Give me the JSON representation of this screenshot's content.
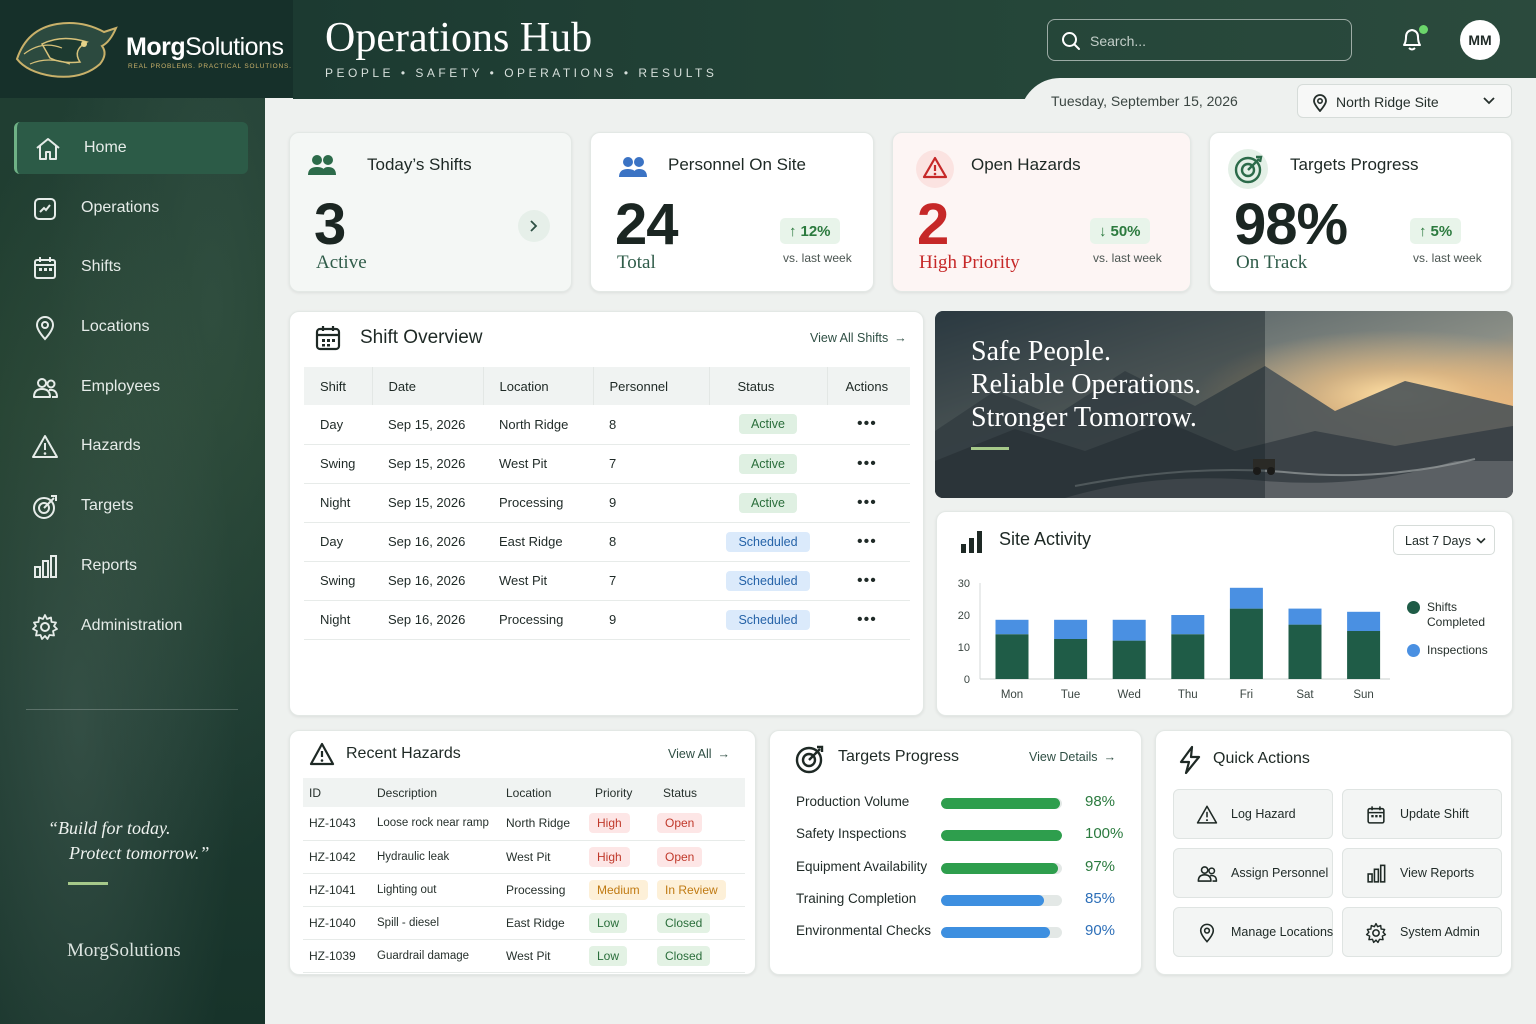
{
  "brand": {
    "name_bold": "Morg",
    "name_light": "Solutions",
    "tagline": "REAL PROBLEMS. PRACTICAL SOLUTIONS."
  },
  "nav": [
    {
      "label": "Home",
      "icon": "home-icon",
      "active": true
    },
    {
      "label": "Operations",
      "icon": "operations-icon"
    },
    {
      "label": "Shifts",
      "icon": "calendar-icon"
    },
    {
      "label": "Locations",
      "icon": "location-pin-icon"
    },
    {
      "label": "Employees",
      "icon": "users-icon"
    },
    {
      "label": "Hazards",
      "icon": "warning-icon"
    },
    {
      "label": "Targets",
      "icon": "target-icon"
    },
    {
      "label": "Reports",
      "icon": "bar-chart-icon"
    },
    {
      "label": "Administration",
      "icon": "gear-icon"
    }
  ],
  "sidebar_quote": {
    "line1": "“Build for today.",
    "line2": "Protect tomorrow.”",
    "signature": "MorgSolutions"
  },
  "header": {
    "title": "Operations Hub",
    "subtitle": "PEOPLE   •   SAFETY   •   OPERATIONS   •   RESULTS",
    "search_placeholder": "Search...",
    "avatar_initials": "MM",
    "date": "Tuesday, September 15, 2026",
    "site": "North Ridge Site"
  },
  "kpis": {
    "shifts": {
      "title": "Today’s Shifts",
      "value": "3",
      "sub": "Active"
    },
    "personnel": {
      "title": "Personnel On Site",
      "value": "24",
      "sub": "Total",
      "delta": "12%",
      "vs": "vs. last week"
    },
    "hazards": {
      "title": "Open Hazards",
      "value": "2",
      "sub": "High Priority",
      "delta": "50%",
      "vs": "vs. last week"
    },
    "targets": {
      "title": "Targets Progress",
      "value": "98%",
      "sub": "On Track",
      "delta": "5%",
      "vs": "vs. last week"
    }
  },
  "shift_overview": {
    "title": "Shift Overview",
    "link": "View All Shifts",
    "columns": [
      "Shift",
      "Date",
      "Location",
      "Personnel",
      "Status",
      "Actions"
    ],
    "rows": [
      {
        "shift": "Day",
        "date": "Sep 15, 2026",
        "location": "North Ridge",
        "personnel": "8",
        "status": "Active"
      },
      {
        "shift": "Swing",
        "date": "Sep 15, 2026",
        "location": "West Pit",
        "personnel": "7",
        "status": "Active"
      },
      {
        "shift": "Night",
        "date": "Sep 15, 2026",
        "location": "Processing",
        "personnel": "9",
        "status": "Active"
      },
      {
        "shift": "Day",
        "date": "Sep 16, 2026",
        "location": "East Ridge",
        "personnel": "8",
        "status": "Scheduled"
      },
      {
        "shift": "Swing",
        "date": "Sep 16, 2026",
        "location": "West Pit",
        "personnel": "7",
        "status": "Scheduled"
      },
      {
        "shift": "Night",
        "date": "Sep 16, 2026",
        "location": "Processing",
        "personnel": "9",
        "status": "Scheduled"
      }
    ],
    "actions_glyph": "•••"
  },
  "hero": {
    "line1": "Safe People.",
    "line2": "Reliable Operations.",
    "line3": "Stronger Tomorrow."
  },
  "site_activity": {
    "title": "Site Activity",
    "range": "Last 7 Days",
    "legend": [
      "Shifts Completed",
      "Inspections"
    ]
  },
  "chart_data": {
    "type": "bar",
    "categories": [
      "Mon",
      "Tue",
      "Wed",
      "Thu",
      "Fri",
      "Sat",
      "Sun"
    ],
    "series": [
      {
        "name": "Shifts Completed",
        "values": [
          14,
          12.5,
          12,
          14,
          22,
          17,
          15
        ],
        "color": "#1f5c47"
      },
      {
        "name": "Inspections",
        "values": [
          4.5,
          6,
          6.5,
          6,
          6.5,
          5,
          6
        ],
        "color": "#4a90e2"
      }
    ],
    "stacked": true,
    "yticks": [
      0,
      10,
      20,
      30
    ],
    "ylim": [
      0,
      30
    ],
    "grid": false,
    "legend_position": "right"
  },
  "recent_hazards": {
    "title": "Recent Hazards",
    "link": "View All",
    "columns": [
      "ID",
      "Description",
      "Location",
      "Priority",
      "Status"
    ],
    "rows": [
      {
        "id": "HZ-1043",
        "desc": "Loose rock near ramp",
        "location": "North Ridge",
        "priority": "High",
        "status": "Open"
      },
      {
        "id": "HZ-1042",
        "desc": "Hydraulic leak",
        "location": "West Pit",
        "priority": "High",
        "status": "Open"
      },
      {
        "id": "HZ-1041",
        "desc": "Lighting out",
        "location": "Processing",
        "priority": "Medium",
        "status": "In Review"
      },
      {
        "id": "HZ-1040",
        "desc": "Spill - diesel",
        "location": "East Ridge",
        "priority": "Low",
        "status": "Closed"
      },
      {
        "id": "HZ-1039",
        "desc": "Guardrail damage",
        "location": "West Pit",
        "priority": "Low",
        "status": "Closed"
      }
    ]
  },
  "targets_progress": {
    "title": "Targets Progress",
    "link": "View Details",
    "items": [
      {
        "name": "Production Volume",
        "value": 98,
        "label": "98%",
        "color": "#2e9e4d"
      },
      {
        "name": "Safety Inspections",
        "value": 100,
        "label": "100%",
        "color": "#2e9e4d"
      },
      {
        "name": "Equipment Availability",
        "value": 97,
        "label": "97%",
        "color": "#2e9e4d"
      },
      {
        "name": "Training Completion",
        "value": 85,
        "label": "85%",
        "color": "#3d8fe0"
      },
      {
        "name": "Environmental Checks",
        "value": 90,
        "label": "90%",
        "color": "#3d8fe0"
      }
    ]
  },
  "quick_actions": {
    "title": "Quick Actions",
    "items": [
      {
        "label": "Log Hazard",
        "icon": "warning-icon"
      },
      {
        "label": "Update Shift",
        "icon": "calendar-icon"
      },
      {
        "label": "Assign Personnel",
        "icon": "users-icon"
      },
      {
        "label": "View Reports",
        "icon": "bar-chart-icon"
      },
      {
        "label": "Manage Locations",
        "icon": "location-pin-icon"
      },
      {
        "label": "System Admin",
        "icon": "gear-icon"
      }
    ]
  },
  "colors": {
    "primary": "#1f5c47",
    "accent_green": "#2e9e4d",
    "accent_blue": "#3d8fe0",
    "danger": "#c62828"
  }
}
